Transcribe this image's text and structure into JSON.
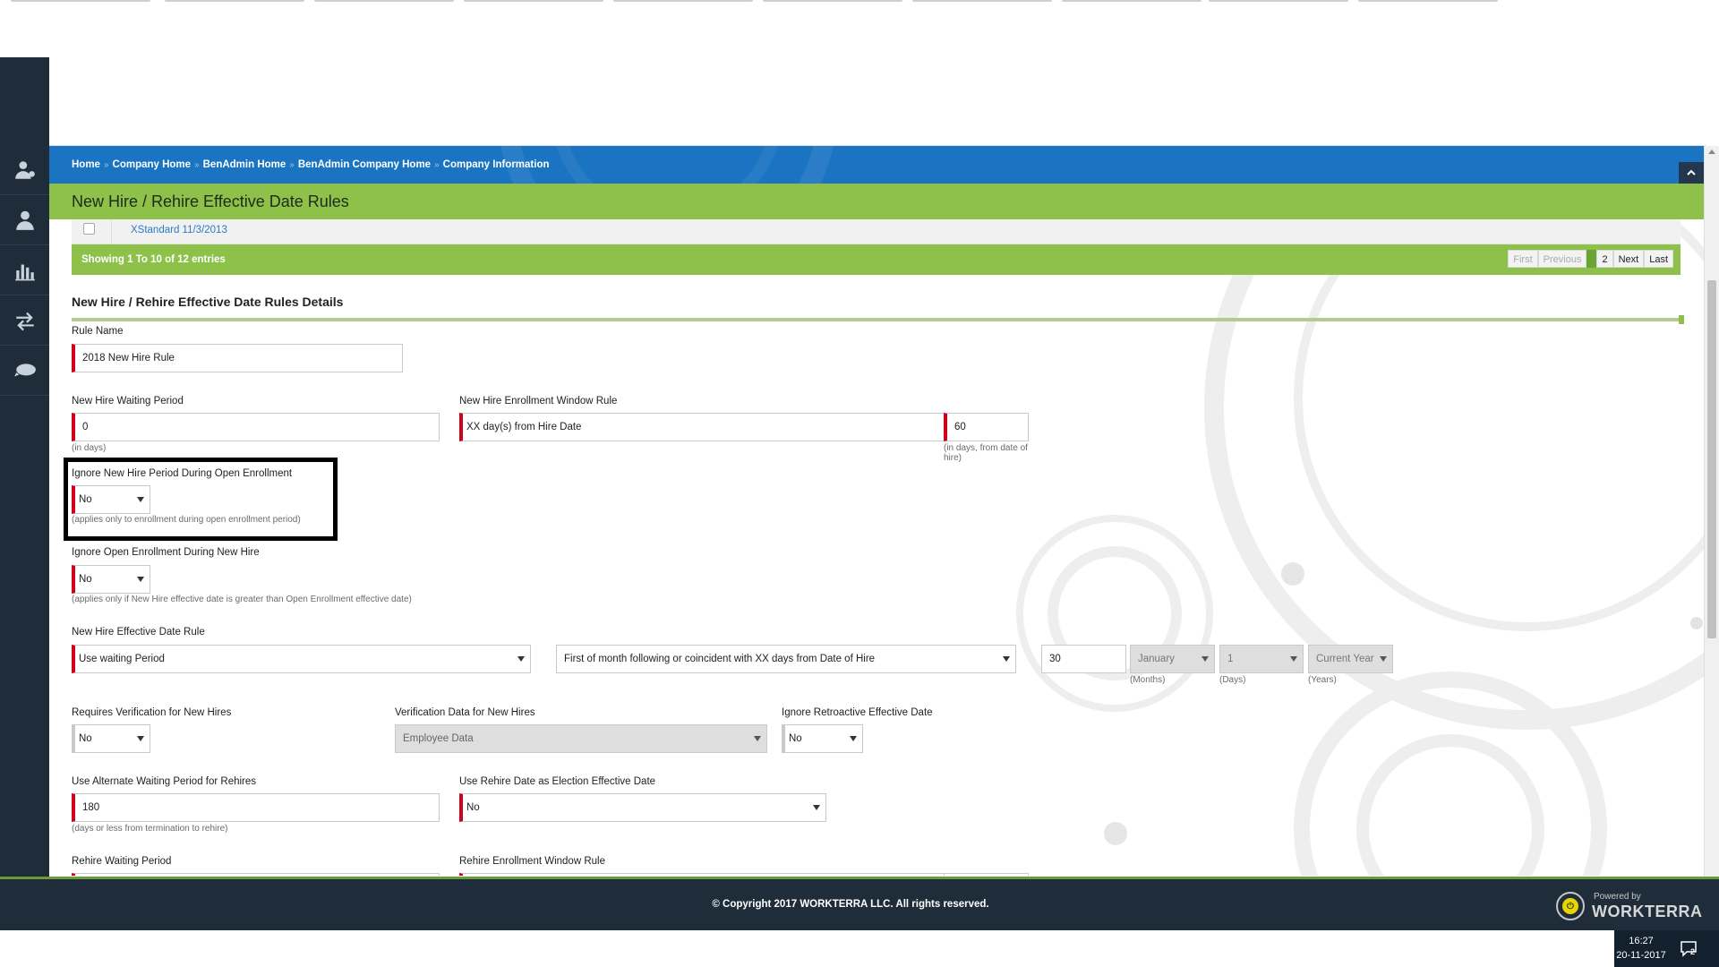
{
  "breadcrumb": {
    "items": [
      "Home",
      "Company Home",
      "BenAdmin Home",
      "BenAdmin Company Home",
      "Company Information"
    ],
    "separator": "»"
  },
  "page": {
    "title": "New Hire / Rehire Effective Date Rules"
  },
  "table": {
    "last_row_link": "XStandard 11/3/2013",
    "entries_info": "Showing 1 To 10 of 12 entries",
    "pager": {
      "first": "First",
      "previous": "Previous",
      "current": "1",
      "page2": "2",
      "next": "Next",
      "last": "Last"
    }
  },
  "details": {
    "heading": "New Hire / Rehire Effective Date Rules Details",
    "rule_name": {
      "label": "Rule Name",
      "value": "2018 New Hire Rule"
    },
    "new_hire_waiting_period": {
      "label": "New Hire Waiting Period",
      "value": "0",
      "hint": "(in days)"
    },
    "new_hire_enrollment_window_rule": {
      "label": "New Hire Enrollment Window Rule",
      "value": "XX day(s) from Hire Date"
    },
    "new_hire_enrollment_days": {
      "value": "60",
      "hint_line1": "(in days, from date of",
      "hint_line2": "hire)"
    },
    "ignore_new_hire_period": {
      "label": "Ignore New Hire Period During Open Enrollment",
      "value": "No",
      "hint": "(applies only to enrollment during open enrollment period)"
    },
    "ignore_open_enrollment": {
      "label": "Ignore Open Enrollment During New Hire",
      "value": "No",
      "hint": "(applies only if New Hire effective date is greater than Open Enrollment effective date)"
    },
    "new_hire_effective_date_rule": {
      "label": "New Hire Effective Date Rule",
      "value": "Use waiting Period",
      "sub_rule": "First of month following or coincident with XX days from Date of Hire",
      "days_value": "30",
      "months_value": "January",
      "months_hint": "(Months)",
      "days_select": "1",
      "days_hint": "(Days)",
      "years_value": "Current Year",
      "years_hint": "(Years)"
    },
    "requires_verification": {
      "label": "Requires Verification for New Hires",
      "value": "No"
    },
    "verification_data": {
      "label": "Verification Data for New Hires",
      "value": "Employee Data"
    },
    "ignore_retroactive": {
      "label": "Ignore Retroactive Effective Date",
      "value": "No"
    },
    "alt_waiting_period_rehires": {
      "label": "Use Alternate Waiting Period for Rehires",
      "value": "180",
      "hint": "(days or less from termination to rehire)"
    },
    "use_rehire_date": {
      "label": "Use Rehire Date as Election Effective Date",
      "value": "No"
    },
    "rehire_waiting_period": {
      "label": "Rehire Waiting Period"
    },
    "rehire_enrollment_window_rule": {
      "label": "Rehire Enrollment Window Rule"
    }
  },
  "footer": {
    "copyright": "© Copyright 2017 WORKTERRA LLC. All rights reserved.",
    "powered_by": "Powered by",
    "brand": "WORKTERRA"
  },
  "taskbar": {
    "time": "16:27",
    "date": "20-11-2017",
    "notification_count": "2"
  },
  "colors": {
    "accent_blue": "#1a74c2",
    "accent_green": "#8dc14a",
    "required_red": "#d0021b",
    "sidebar_dark": "#1f2d3a"
  }
}
